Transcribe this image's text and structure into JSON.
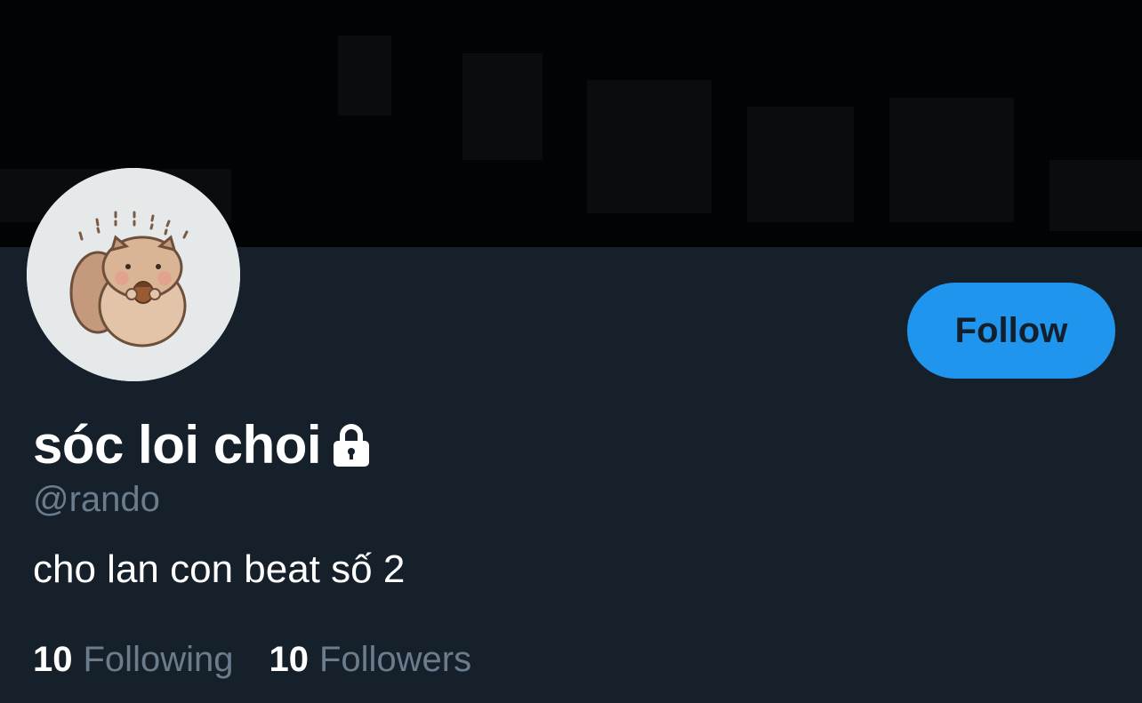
{
  "profile": {
    "display_name": "sóc loi choi",
    "handle": "@rando",
    "bio": "cho lan con beat số 2",
    "protected_icon": "lock-icon",
    "avatar_icon": "squirrel-avatar"
  },
  "actions": {
    "follow_label": "Follow"
  },
  "stats": {
    "following_count": "10",
    "following_label": "Following",
    "followers_count": "10",
    "followers_label": "Followers"
  },
  "colors": {
    "background": "#16202b",
    "banner": "#020304",
    "accent": "#1f95ee",
    "muted_text": "#6b7c8d",
    "text": "#ffffff"
  }
}
